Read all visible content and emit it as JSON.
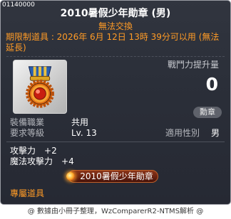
{
  "item": {
    "id": "01140000",
    "name": "2010暑假少年勛章 (男)",
    "trade_status": "無法交換",
    "expiry_note": "期限制道具 : 2026年 6月 12日 13時 39分可以用 (無法延長)",
    "icon": "medal-icon"
  },
  "power": {
    "label": "戰鬥力提升量",
    "value": "0"
  },
  "category": "勳章",
  "requirements": {
    "job": {
      "label": "裝備職業",
      "value": "共用"
    },
    "level": {
      "label": "要求等級",
      "value": "Lv. 13"
    },
    "gender": {
      "label": "適用性別",
      "value": "男"
    }
  },
  "stats": [
    {
      "label": "攻擊力",
      "value": "+2"
    },
    {
      "label": "魔法攻擊力",
      "value": "+4"
    }
  ],
  "set_item": {
    "label": "2010暑假少年勛章",
    "icon": "glowing-orb-icon"
  },
  "exclusive_note": "專屬道具",
  "footer": "@ 數據由小冊子整理，WzComparerR2-NTMS解析 @",
  "colors": {
    "panel": "#2b2f39",
    "orange": "#ff9b26",
    "label": "#b4b6bc",
    "text": "#ffffff",
    "set": "#6a2210"
  }
}
